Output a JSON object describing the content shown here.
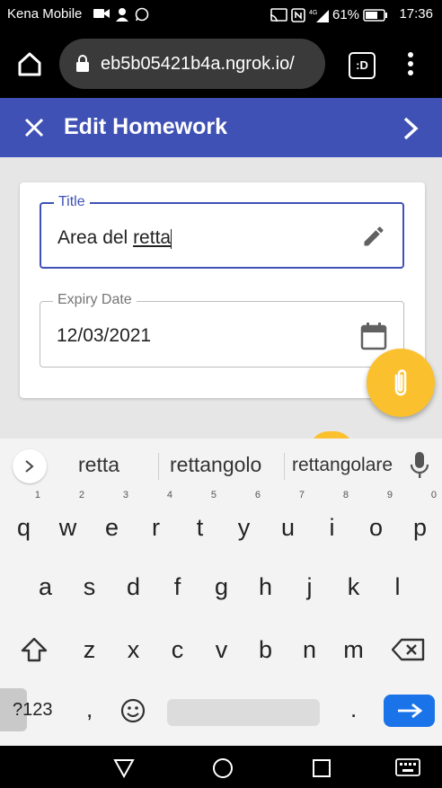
{
  "status_bar": {
    "carrier": "Kena Mobile",
    "battery": "61%",
    "time": "17:36"
  },
  "browser": {
    "url": "eb5b05421b4a.ngrok.io/",
    "tab_count": ":D"
  },
  "app_bar": {
    "title": "Edit Homework",
    "accent": "#3f51b5"
  },
  "form": {
    "title_label": "Title",
    "title_value_prefix": "Area del ",
    "title_value_word": "retta",
    "expiry_label": "Expiry Date",
    "expiry_value": "12/03/2021"
  },
  "fab": {
    "icon": "paperclip-icon",
    "color": "#fbc02d"
  },
  "keyboard": {
    "suggestions": [
      "retta",
      "rettangolo",
      "rettangolare"
    ],
    "row1": [
      [
        "q",
        "1"
      ],
      [
        "w",
        "2"
      ],
      [
        "e",
        "3"
      ],
      [
        "r",
        "4"
      ],
      [
        "t",
        "5"
      ],
      [
        "y",
        "6"
      ],
      [
        "u",
        "7"
      ],
      [
        "i",
        "8"
      ],
      [
        "o",
        "9"
      ],
      [
        "p",
        "0"
      ]
    ],
    "row2": [
      "a",
      "s",
      "d",
      "f",
      "g",
      "h",
      "j",
      "k",
      "l"
    ],
    "row3": [
      "z",
      "x",
      "c",
      "v",
      "b",
      "n",
      "m"
    ],
    "symbols_label": "?123",
    "comma": ",",
    "period": "."
  }
}
